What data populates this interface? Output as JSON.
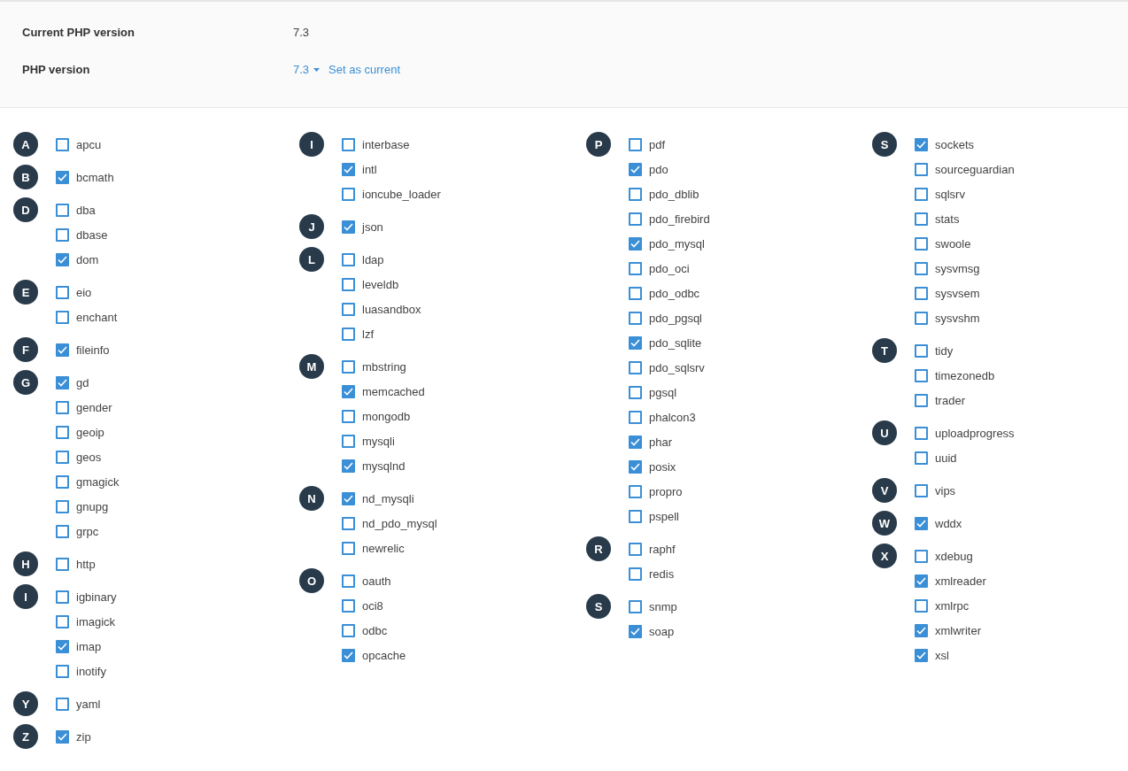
{
  "settings": [
    {
      "label": "Current PHP version",
      "kind": "text",
      "value": "7.3"
    },
    {
      "label": "PHP version",
      "kind": "select",
      "value": "7.3",
      "action": "Set as current"
    }
  ],
  "columns": [
    [
      {
        "letter": "A",
        "items": [
          {
            "name": "apcu",
            "checked": false
          }
        ]
      },
      {
        "letter": "B",
        "items": [
          {
            "name": "bcmath",
            "checked": true
          }
        ]
      },
      {
        "letter": "D",
        "items": [
          {
            "name": "dba",
            "checked": false
          },
          {
            "name": "dbase",
            "checked": false
          },
          {
            "name": "dom",
            "checked": true
          }
        ]
      },
      {
        "letter": "E",
        "items": [
          {
            "name": "eio",
            "checked": false
          },
          {
            "name": "enchant",
            "checked": false
          }
        ]
      },
      {
        "letter": "F",
        "items": [
          {
            "name": "fileinfo",
            "checked": true
          }
        ]
      },
      {
        "letter": "G",
        "items": [
          {
            "name": "gd",
            "checked": true
          },
          {
            "name": "gender",
            "checked": false
          },
          {
            "name": "geoip",
            "checked": false
          },
          {
            "name": "geos",
            "checked": false
          },
          {
            "name": "gmagick",
            "checked": false
          },
          {
            "name": "gnupg",
            "checked": false
          },
          {
            "name": "grpc",
            "checked": false
          }
        ]
      },
      {
        "letter": "H",
        "items": [
          {
            "name": "http",
            "checked": false
          }
        ]
      },
      {
        "letter": "I",
        "items": [
          {
            "name": "igbinary",
            "checked": false
          },
          {
            "name": "imagick",
            "checked": false
          },
          {
            "name": "imap",
            "checked": true
          },
          {
            "name": "inotify",
            "checked": false
          }
        ]
      },
      {
        "letter": "Y",
        "items": [
          {
            "name": "yaml",
            "checked": false
          }
        ]
      },
      {
        "letter": "Z",
        "items": [
          {
            "name": "zip",
            "checked": true
          }
        ]
      }
    ],
    [
      {
        "letter": "I",
        "items": [
          {
            "name": "interbase",
            "checked": false
          },
          {
            "name": "intl",
            "checked": true
          },
          {
            "name": "ioncube_loader",
            "checked": false
          }
        ]
      },
      {
        "letter": "J",
        "items": [
          {
            "name": "json",
            "checked": true
          }
        ]
      },
      {
        "letter": "L",
        "items": [
          {
            "name": "ldap",
            "checked": false
          },
          {
            "name": "leveldb",
            "checked": false
          },
          {
            "name": "luasandbox",
            "checked": false
          },
          {
            "name": "lzf",
            "checked": false
          }
        ]
      },
      {
        "letter": "M",
        "items": [
          {
            "name": "mbstring",
            "checked": false
          },
          {
            "name": "memcached",
            "checked": true
          },
          {
            "name": "mongodb",
            "checked": false
          },
          {
            "name": "mysqli",
            "checked": false
          },
          {
            "name": "mysqlnd",
            "checked": true
          }
        ]
      },
      {
        "letter": "N",
        "items": [
          {
            "name": "nd_mysqli",
            "checked": true
          },
          {
            "name": "nd_pdo_mysql",
            "checked": false
          },
          {
            "name": "newrelic",
            "checked": false
          }
        ]
      },
      {
        "letter": "O",
        "items": [
          {
            "name": "oauth",
            "checked": false
          },
          {
            "name": "oci8",
            "checked": false
          },
          {
            "name": "odbc",
            "checked": false
          },
          {
            "name": "opcache",
            "checked": true
          }
        ]
      }
    ],
    [
      {
        "letter": "P",
        "items": [
          {
            "name": "pdf",
            "checked": false
          },
          {
            "name": "pdo",
            "checked": true
          },
          {
            "name": "pdo_dblib",
            "checked": false
          },
          {
            "name": "pdo_firebird",
            "checked": false
          },
          {
            "name": "pdo_mysql",
            "checked": true
          },
          {
            "name": "pdo_oci",
            "checked": false
          },
          {
            "name": "pdo_odbc",
            "checked": false
          },
          {
            "name": "pdo_pgsql",
            "checked": false
          },
          {
            "name": "pdo_sqlite",
            "checked": true
          },
          {
            "name": "pdo_sqlsrv",
            "checked": false
          },
          {
            "name": "pgsql",
            "checked": false
          },
          {
            "name": "phalcon3",
            "checked": false
          },
          {
            "name": "phar",
            "checked": true
          },
          {
            "name": "posix",
            "checked": true
          },
          {
            "name": "propro",
            "checked": false
          },
          {
            "name": "pspell",
            "checked": false
          }
        ]
      },
      {
        "letter": "R",
        "items": [
          {
            "name": "raphf",
            "checked": false
          },
          {
            "name": "redis",
            "checked": false
          }
        ]
      },
      {
        "letter": "S",
        "items": [
          {
            "name": "snmp",
            "checked": false
          },
          {
            "name": "soap",
            "checked": true
          }
        ]
      }
    ],
    [
      {
        "letter": "S",
        "items": [
          {
            "name": "sockets",
            "checked": true
          },
          {
            "name": "sourceguardian",
            "checked": false
          },
          {
            "name": "sqlsrv",
            "checked": false
          },
          {
            "name": "stats",
            "checked": false
          },
          {
            "name": "swoole",
            "checked": false
          },
          {
            "name": "sysvmsg",
            "checked": false
          },
          {
            "name": "sysvsem",
            "checked": false
          },
          {
            "name": "sysvshm",
            "checked": false
          }
        ]
      },
      {
        "letter": "T",
        "items": [
          {
            "name": "tidy",
            "checked": false
          },
          {
            "name": "timezonedb",
            "checked": false
          },
          {
            "name": "trader",
            "checked": false
          }
        ]
      },
      {
        "letter": "U",
        "items": [
          {
            "name": "uploadprogress",
            "checked": false
          },
          {
            "name": "uuid",
            "checked": false
          }
        ]
      },
      {
        "letter": "V",
        "items": [
          {
            "name": "vips",
            "checked": false
          }
        ]
      },
      {
        "letter": "W",
        "items": [
          {
            "name": "wddx",
            "checked": true
          }
        ]
      },
      {
        "letter": "X",
        "items": [
          {
            "name": "xdebug",
            "checked": false
          },
          {
            "name": "xmlreader",
            "checked": true
          },
          {
            "name": "xmlrpc",
            "checked": false
          },
          {
            "name": "xmlwriter",
            "checked": true
          },
          {
            "name": "xsl",
            "checked": true
          }
        ]
      }
    ]
  ]
}
